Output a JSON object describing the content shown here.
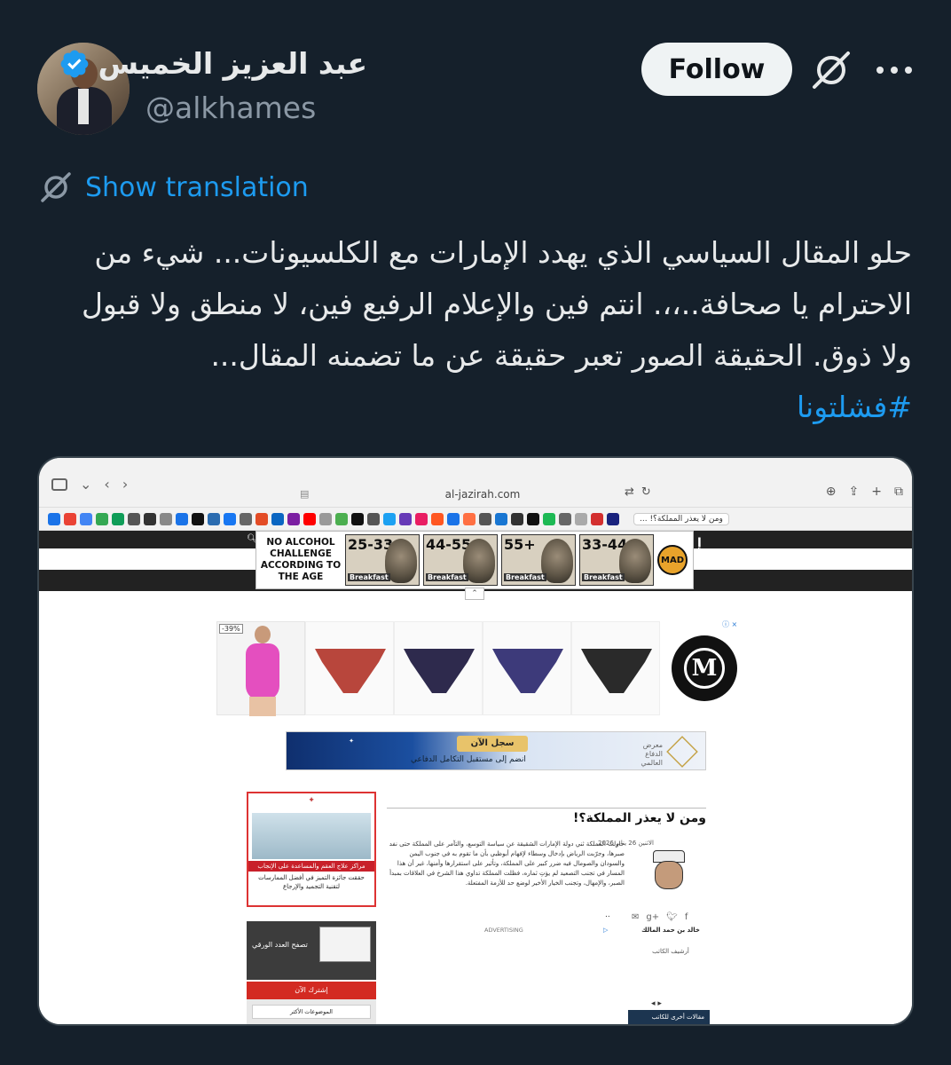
{
  "tweet": {
    "display_name": "عبد العزيز الخميس",
    "handle": "@alkhames",
    "follow_label": "Follow",
    "translate_label": "Show translation",
    "text": "حلو المقال السياسي الذي يهدد الإمارات مع الكلسيونات... شيء من الاحترام يا صحافة..،،. انتم فين والإعلام الرفيع فين، لا منطق ولا قبول ولا ذوق. الحقيقة الصور تعبر حقيقة عن ما تضمنه المقال...",
    "hashtag": "#فشلتونا",
    "colors": {
      "background": "#15202b",
      "link": "#1d9bf0",
      "text": "#e7e9ea",
      "muted": "#8b98a5"
    },
    "icons": [
      "verified-badge-icon",
      "grok-icon",
      "more-icon",
      "translate-icon"
    ]
  },
  "screenshot": {
    "browser": {
      "url": "al-jazirah.com",
      "bookmark_tab_label": "ومن لا يعذر المملكة؟! ..."
    },
    "top_ad": {
      "headline": "NO ALCOHOL CHALLENGE ACCORDING TO THE AGE",
      "ages": [
        "25-33",
        "44-55",
        "55+",
        "33-44"
      ],
      "tag": "Breakfast",
      "brand": "MAD"
    },
    "lingerie_ad": {
      "discount": "-39%",
      "logo_letter": "M"
    },
    "military_banner": {
      "cta": "سجل الآن",
      "subtitle": "انضم إلى مستقبل التكامل الدفاعي",
      "event": "معرض الدفاع العالمي"
    },
    "side_ad": {
      "banner": "مراكز علاج العقم والمساعدة على الإنجاب",
      "text": "حققت جائزة التميز في أفضل الممارسات لتقنية التجميد والإرجاع"
    },
    "article": {
      "title": "ومن لا يعذر المملكة؟!",
      "date": "الاثنين 26 يناير 2026",
      "body": "حاولت المملكة ثني دولة الإمارات الشقيقة عن سياسة التوسع، والتآمر على المملكة حتى نفد صبرها، وجرّبت الرياض بإدخال وسطاء لإفهام أبوظبي بأن ما تقوم به في جنوب اليمن والسودان والصومال فيه ضرر كبير على المملكة، وتأثير على استقرارها وأمنها، غير أن هذا المسار في تجنب التصعيد لم يؤتِ ثماره، فظلت المملكة تداوي هذا الشرخ في العلاقات بمبدأ الصبر، والإمهال، وتجنب الخيار الأخير لوضع حد للأزمة المفتعلة.",
      "more": "..",
      "advertising": "ADVERTISING",
      "author": "خالد بن حمد المالك",
      "archive": "أرشيف الكاتب",
      "more_articles": "مقالات أخرى للكاتب"
    },
    "paper_box": {
      "label": "تصفح العدد الورقي",
      "subscribe": "إشترك الآن",
      "most_read": "الموضوعات الأكثر"
    }
  }
}
